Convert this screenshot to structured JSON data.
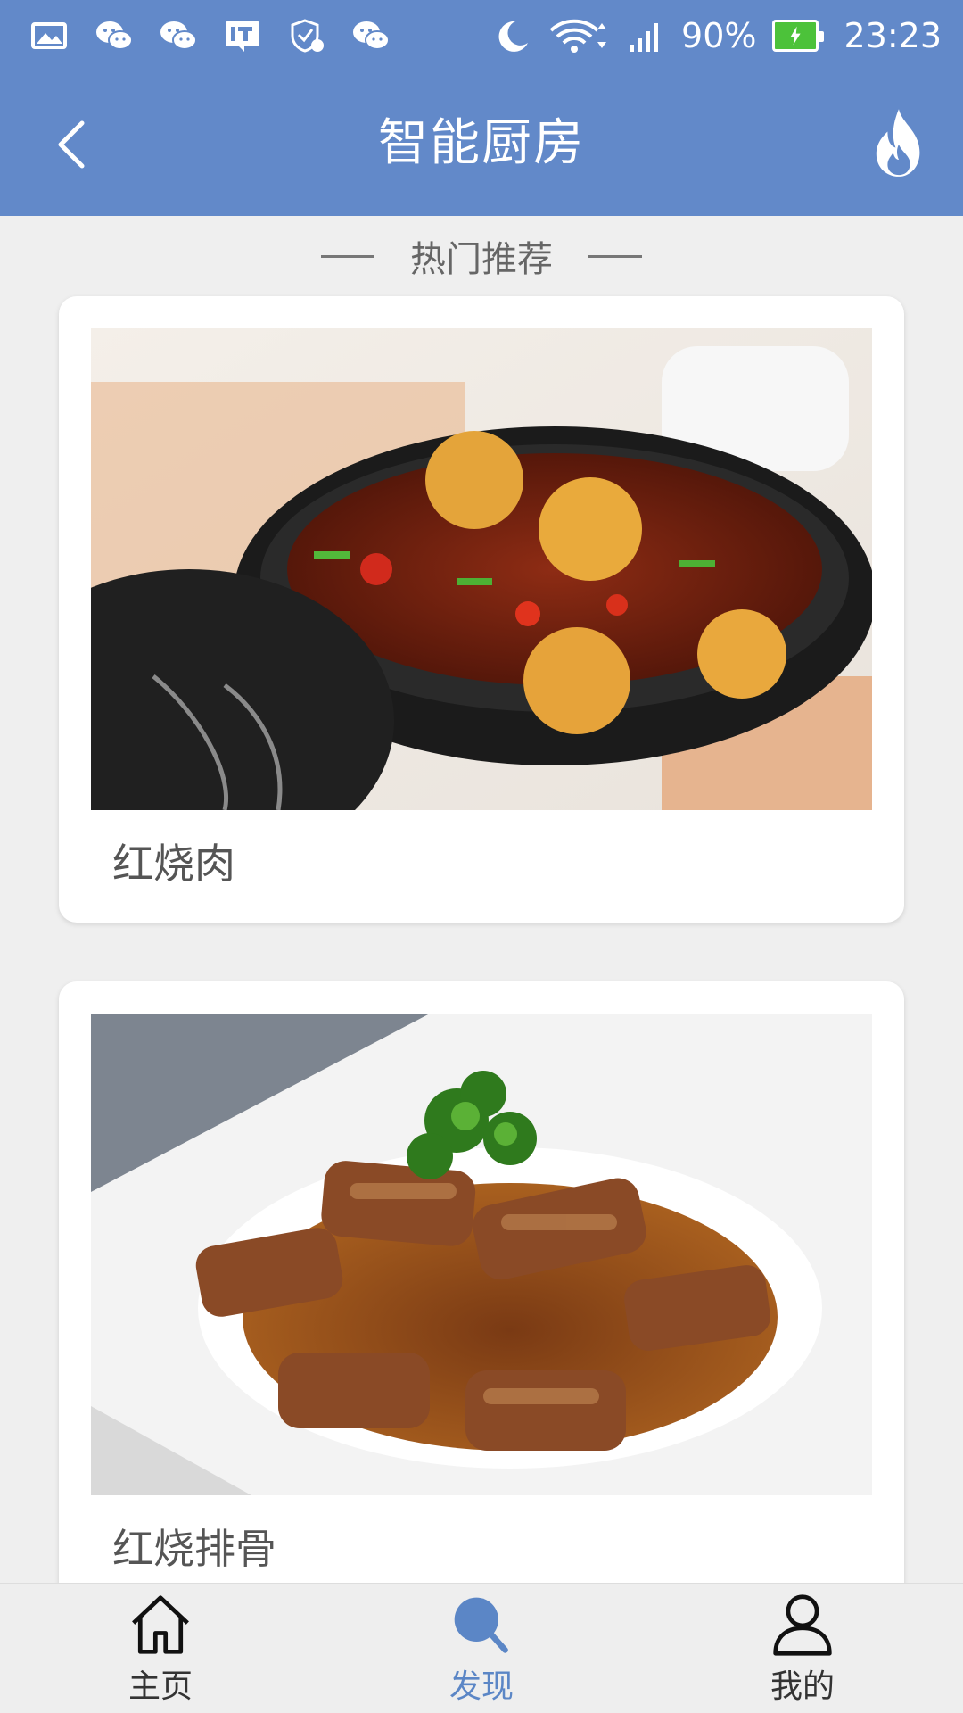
{
  "status_bar": {
    "battery_percent": "90%",
    "time": "23:23",
    "icons": [
      "gallery-icon",
      "wechat-icon",
      "wechat-icon",
      "it-news-icon",
      "shield-notification-icon",
      "wechat-icon",
      "moon-icon",
      "wifi-icon",
      "signal-icon",
      "battery-charging-icon"
    ]
  },
  "header": {
    "title": "智能厨房",
    "back_icon": "chevron-left-icon",
    "action_icon": "fire-icon"
  },
  "section": {
    "title": "热门推荐"
  },
  "recipes": [
    {
      "name": "红烧肉",
      "image": "braised-pork-photo"
    },
    {
      "name": "红烧排骨",
      "image": "braised-ribs-photo"
    }
  ],
  "bottom_nav": {
    "items": [
      {
        "label": "主页",
        "icon": "home-icon",
        "active": false
      },
      {
        "label": "发现",
        "icon": "search-icon",
        "active": true
      },
      {
        "label": "我的",
        "icon": "user-icon",
        "active": false
      }
    ]
  },
  "colors": {
    "header": "#6289c9",
    "accent": "#5b86c6",
    "background": "#efefef"
  }
}
